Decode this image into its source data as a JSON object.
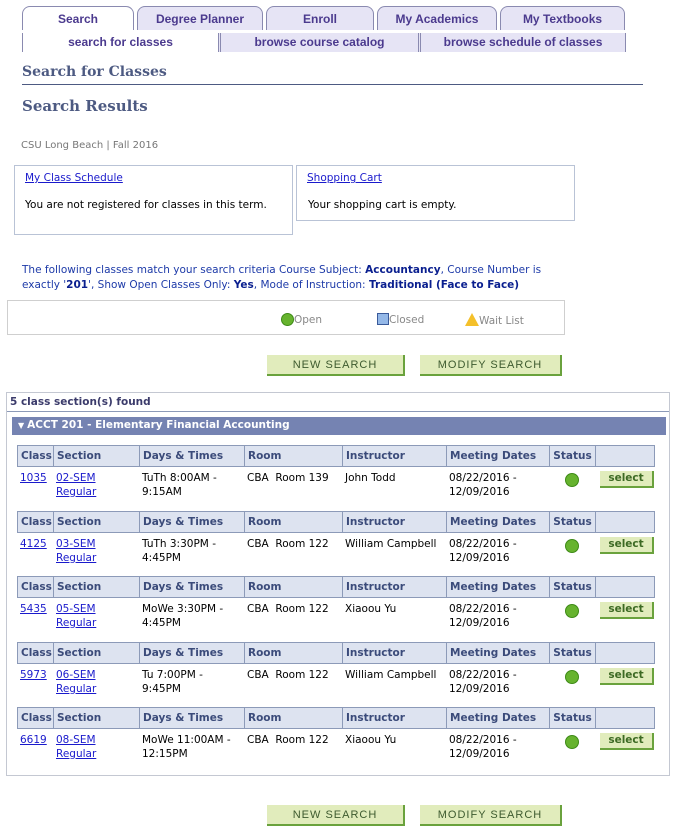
{
  "tabs": [
    {
      "label": "Search",
      "active": true
    },
    {
      "label": "Degree Planner",
      "active": false
    },
    {
      "label": "Enroll",
      "active": false
    },
    {
      "label": "My Academics",
      "active": false
    },
    {
      "label": "My Textbooks",
      "active": false
    }
  ],
  "subtabs": [
    {
      "label": "search for classes",
      "active": true
    },
    {
      "label": "browse course catalog",
      "active": false
    },
    {
      "label": "browse schedule of classes",
      "active": false
    }
  ],
  "page_title": "Search for Classes",
  "section_title": "Search Results",
  "term_info": "CSU Long Beach | Fall 2016",
  "class_schedule": {
    "link": "My Class Schedule",
    "message": "You are not registered for classes in this term."
  },
  "shopping_cart": {
    "link": "Shopping Cart",
    "message": "Your shopping cart is empty."
  },
  "criteria": {
    "intro": "The following classes match your search criteria Course Subject: ",
    "subject": "Accountancy",
    "number_label": ",  Course Number is exactly '",
    "number": "201",
    "open_label": "',  Show Open Classes Only: ",
    "open": "Yes",
    "mode_label": ",  Mode of Instruction: ",
    "mode": "Traditional (Face to Face)"
  },
  "legend": {
    "open": "Open",
    "closed": "Closed",
    "wait_list": "Wait List"
  },
  "buttons": {
    "new_search": "NEW SEARCH",
    "modify_search": "MODIFY SEARCH",
    "select": "select"
  },
  "results": {
    "found_text": "5 class section(s) found",
    "course_title": "ACCT 201 - Elementary Financial Accounting",
    "headers": [
      "Class",
      "Section",
      "Days & Times",
      "Room",
      "Instructor",
      "Meeting Dates",
      "Status"
    ],
    "sections": [
      {
        "class": "1035",
        "section": "02-SEM",
        "session": "Regular",
        "days_times": "TuTh 8:00AM - 9:15AM",
        "room": "CBA  Room 139",
        "instructor": "John Todd",
        "dates": "08/22/2016 - 12/09/2016",
        "status": "Open"
      },
      {
        "class": "4125",
        "section": "03-SEM",
        "session": "Regular",
        "days_times": "TuTh 3:30PM - 4:45PM",
        "room": "CBA  Room 122",
        "instructor": "William Campbell",
        "dates": "08/22/2016 - 12/09/2016",
        "status": "Open"
      },
      {
        "class": "5435",
        "section": "05-SEM",
        "session": "Regular",
        "days_times": "MoWe 3:30PM - 4:45PM",
        "room": "CBA  Room 122",
        "instructor": "Xiaoou Yu",
        "dates": "08/22/2016 - 12/09/2016",
        "status": "Open"
      },
      {
        "class": "5973",
        "section": "06-SEM",
        "session": "Regular",
        "days_times": "Tu 7:00PM - 9:45PM",
        "room": "CBA  Room 122",
        "instructor": "William Campbell",
        "dates": "08/22/2016 - 12/09/2016",
        "status": "Open"
      },
      {
        "class": "6619",
        "section": "08-SEM",
        "session": "Regular",
        "days_times": "MoWe 11:00AM - 12:15PM",
        "room": "CBA  Room 122",
        "instructor": "Xiaoou Yu",
        "dates": "08/22/2016 - 12/09/2016",
        "status": "Open"
      }
    ]
  }
}
